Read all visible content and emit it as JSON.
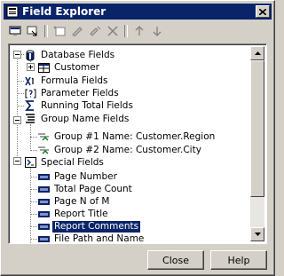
{
  "window": {
    "title": "Field Explorer",
    "close_icon": "close-icon"
  },
  "toolbar": {
    "buttons": [
      {
        "icon": "browse-icon"
      },
      {
        "icon": "insert-icon"
      },
      {
        "icon": "new-icon"
      },
      {
        "icon": "edit-icon"
      },
      {
        "icon": "rename-icon"
      },
      {
        "icon": "delete-icon"
      },
      {
        "icon": "move-up-icon"
      },
      {
        "icon": "move-down-icon"
      }
    ]
  },
  "tree": {
    "database_fields": "Database Fields",
    "customer": "Customer",
    "formula_fields": "Formula Fields",
    "parameter_fields": "Parameter Fields",
    "running_total_fields": "Running Total Fields",
    "group_name_fields": "Group Name Fields",
    "group1": "Group #1 Name: Customer.Region",
    "group2": "Group #2 Name: Customer.City",
    "special_fields": "Special Fields",
    "page_number": "Page Number",
    "total_page_count": "Total Page Count",
    "page_n_of_m": "Page N of M",
    "report_title": "Report Title",
    "report_comments": "Report Comments",
    "file_path_and_name": "File Path and Name"
  },
  "buttons": {
    "close": "Close",
    "help": "Help"
  }
}
